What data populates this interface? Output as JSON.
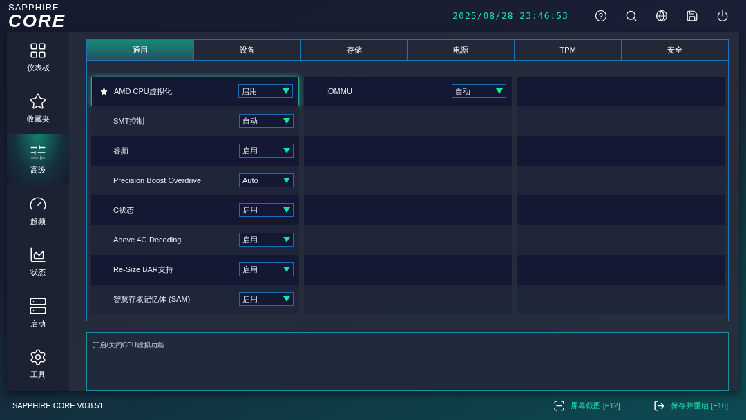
{
  "header": {
    "logo_top": "SAPPHIRE",
    "logo_main": "CORE",
    "datetime": "2025/08/28 23:46:53"
  },
  "sidebar": {
    "items": [
      {
        "label": "仪表板",
        "kind": "dashboard",
        "selected": false
      },
      {
        "label": "收藏夹",
        "kind": "favorites",
        "selected": false
      },
      {
        "label": "高级",
        "kind": "advanced",
        "selected": true
      },
      {
        "label": "超频",
        "kind": "overclock",
        "selected": false
      },
      {
        "label": "状态",
        "kind": "status",
        "selected": false
      },
      {
        "label": "启动",
        "kind": "boot",
        "selected": false
      },
      {
        "label": "工具",
        "kind": "tools",
        "selected": false
      }
    ]
  },
  "tabs": [
    {
      "label": "通用",
      "selected": true
    },
    {
      "label": "设备",
      "selected": false
    },
    {
      "label": "存储",
      "selected": false
    },
    {
      "label": "电源",
      "selected": false
    },
    {
      "label": "TPM",
      "selected": false
    },
    {
      "label": "安全",
      "selected": false
    }
  ],
  "settings_columns": [
    {
      "items": [
        {
          "label": "AMD CPU虚拟化",
          "value": "启用",
          "starred": true,
          "selected": true
        },
        {
          "label": "SMT控制",
          "value": "自动",
          "starred": false,
          "selected": false
        },
        {
          "label": "睿频",
          "value": "启用",
          "starred": false,
          "selected": false
        },
        {
          "label": "Precision Boost Overdrive",
          "value": "Auto",
          "starred": false,
          "selected": false
        },
        {
          "label": "C状态",
          "value": "启用",
          "starred": false,
          "selected": false
        },
        {
          "label": "Above 4G Decoding",
          "value": "启用",
          "starred": false,
          "selected": false
        },
        {
          "label": "Re-Size BAR支持",
          "value": "启用",
          "starred": false,
          "selected": false
        },
        {
          "label": "智慧存取记忆体 (SAM)",
          "value": "启用",
          "starred": false,
          "selected": false
        }
      ]
    },
    {
      "items": [
        {
          "label": "IOMMU",
          "value": "自动",
          "starred": false,
          "selected": false
        }
      ]
    }
  ],
  "description": "开启/关闭CPU虚拟功能",
  "footer": {
    "version": "SAPPHIRE CORE V0.8.51",
    "actions": [
      {
        "label": "屏幕截图 [F12]",
        "kind": "screenshot"
      },
      {
        "label": "保存并重启 [F10]",
        "kind": "exit"
      }
    ]
  }
}
